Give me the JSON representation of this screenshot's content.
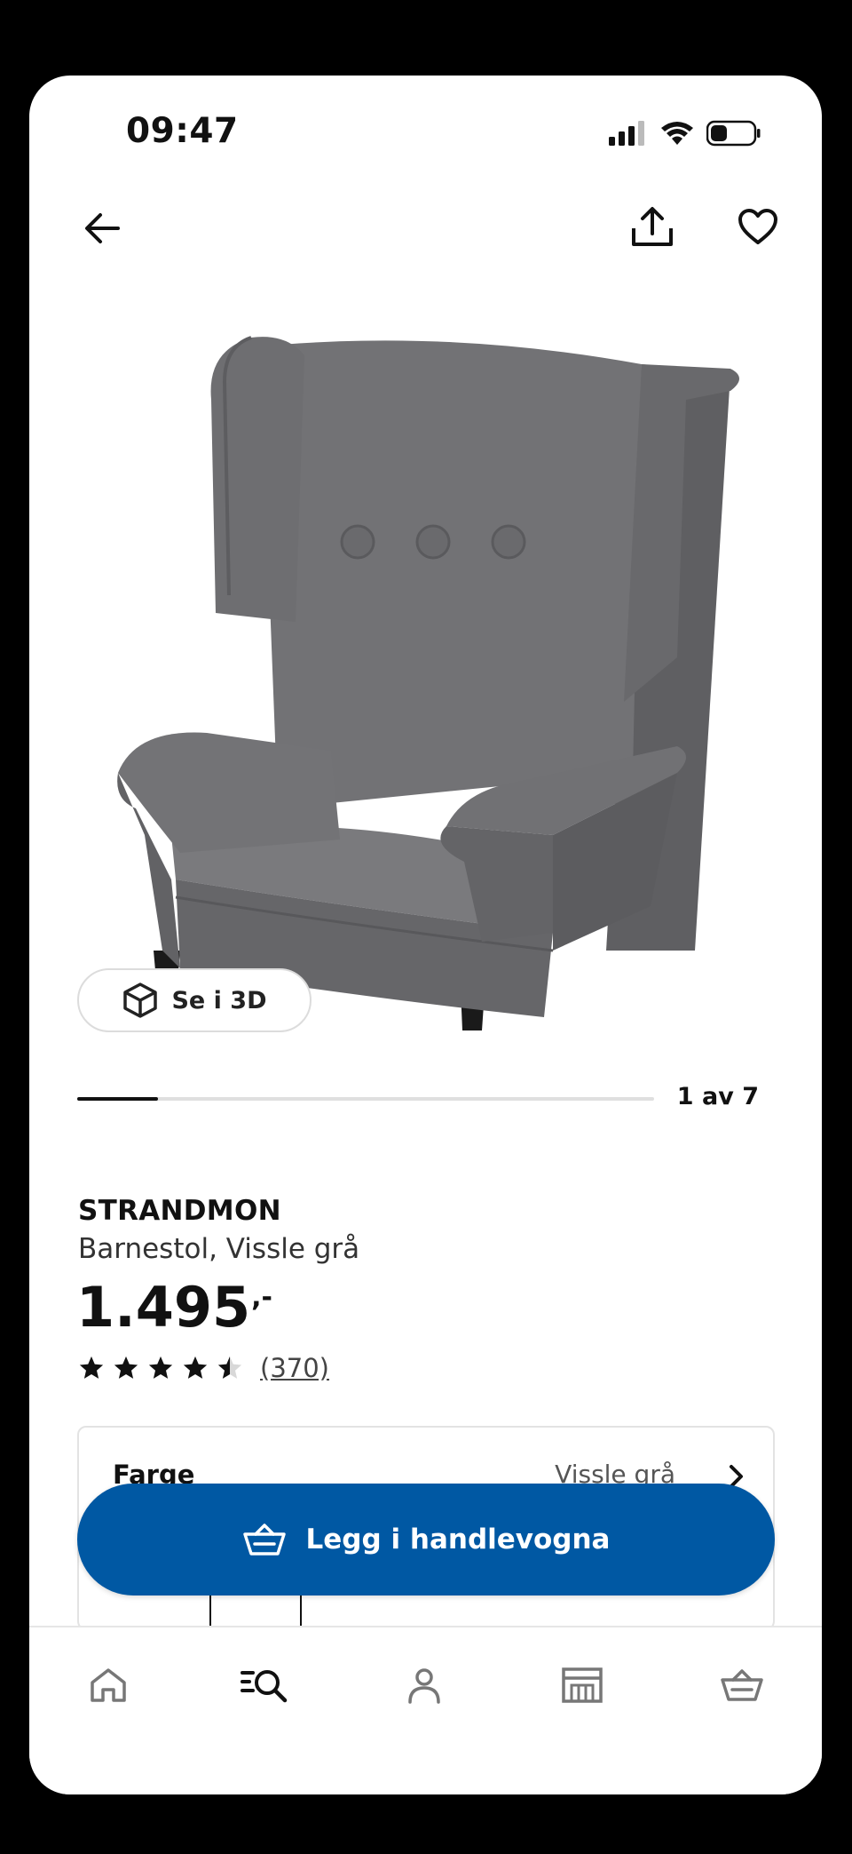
{
  "status_bar": {
    "time": "09:47"
  },
  "header": {
    "back_icon": "arrow-left-icon",
    "share_icon": "share-icon",
    "favorite_icon": "heart-icon"
  },
  "gallery": {
    "view_3d_label": "Se i 3D",
    "counter": "1 av 7",
    "progress": 0.14
  },
  "product": {
    "name": "STRANDMON",
    "description": "Barnestol, Vissle grå",
    "price": "1.495",
    "price_suffix": ",-",
    "rating": 4.5,
    "review_count": "(370)"
  },
  "options": {
    "label": "Farge",
    "value": "Vissle grå"
  },
  "cart_button": {
    "label": "Legg i handlevogna"
  },
  "bottom_nav": {
    "items": [
      {
        "name": "home",
        "icon": "home-icon"
      },
      {
        "name": "search",
        "icon": "search-icon",
        "active": true
      },
      {
        "name": "profile",
        "icon": "user-icon"
      },
      {
        "name": "stores",
        "icon": "store-icon"
      },
      {
        "name": "cart",
        "icon": "basket-icon"
      }
    ]
  },
  "colors": {
    "accent": "#0058a3",
    "text": "#111111",
    "chair": "#6b6b6e"
  }
}
